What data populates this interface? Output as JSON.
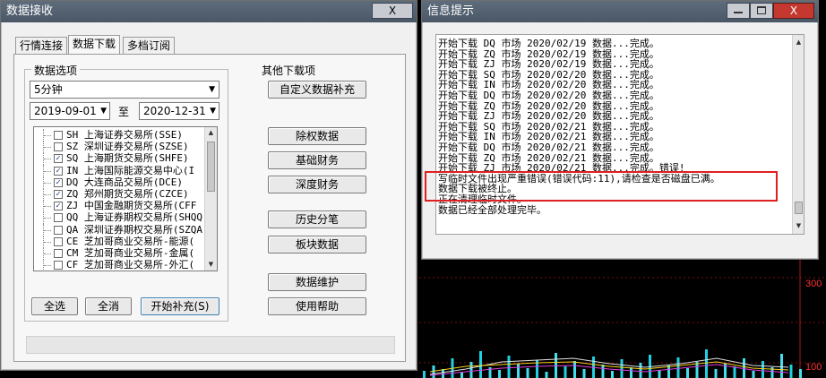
{
  "background": {
    "axis_labels": [
      "300",
      "100"
    ]
  },
  "data_window": {
    "title": "数据接收",
    "close_label": "X",
    "tabs": [
      "行情连接",
      "数据下载",
      "多档订阅"
    ],
    "active_tab": "数据下载",
    "data_options": {
      "group_title": "数据选项",
      "period": "5分钟",
      "start_date": "2019-09-01",
      "to_label": "至",
      "end_date": "2020-12-31",
      "markets": [
        {
          "checked": false,
          "text": "SH 上海证券交易所(SSE)"
        },
        {
          "checked": false,
          "text": "SZ 深圳证券交易所(SZSE)"
        },
        {
          "checked": true,
          "text": "SQ 上海期货交易所(SHFE)"
        },
        {
          "checked": true,
          "text": "IN 上海国际能源交易中心(I"
        },
        {
          "checked": true,
          "text": "DQ 大连商品交易所(DCE)"
        },
        {
          "checked": true,
          "text": "ZQ 郑州期货交易所(CZCE)"
        },
        {
          "checked": true,
          "text": "ZJ 中国金融期货交易所(CFF"
        },
        {
          "checked": false,
          "text": "QQ 上海证券期权交易所(SHQQ)"
        },
        {
          "checked": false,
          "text": "QA 深圳证券期权交易所(SZQA)"
        },
        {
          "checked": false,
          "text": "CE 芝加哥商业交易所-能源("
        },
        {
          "checked": false,
          "text": "CM 芝加哥商业交易所-金属("
        },
        {
          "checked": false,
          "text": "CF 芝加哥商业交易所-外汇("
        }
      ],
      "select_all": "全选",
      "select_none": "全消",
      "start_supplement": "开始补充(S)"
    },
    "other_downloads": {
      "group_title": "其他下载项",
      "custom_supplement": "自定义数据补充",
      "buttons": [
        "除权数据",
        "基础财务",
        "深度财务",
        "历史分笔",
        "板块数据"
      ],
      "data_maintenance": "数据维护",
      "help": "使用帮助"
    }
  },
  "info_window": {
    "title": "信息提示",
    "log_lines": [
      "开始下载 DQ 市场 2020/02/19 数据...完成。",
      "开始下载 ZQ 市场 2020/02/19 数据...完成。",
      "开始下载 ZJ 市场 2020/02/19 数据...完成。",
      "开始下载 SQ 市场 2020/02/20 数据...完成。",
      "开始下载 IN 市场 2020/02/20 数据...完成。",
      "开始下载 DQ 市场 2020/02/20 数据...完成。",
      "开始下载 ZQ 市场 2020/02/20 数据...完成。",
      "开始下载 ZJ 市场 2020/02/20 数据...完成。",
      "开始下载 SQ 市场 2020/02/21 数据...完成。",
      "开始下载 IN 市场 2020/02/21 数据...完成。",
      "开始下载 DQ 市场 2020/02/21 数据...完成。",
      "开始下载 ZQ 市场 2020/02/21 数据...完成。",
      "开始下载 ZJ 市场 2020/02/21 数据...完成。错误!",
      "写临时文件出现严重错误(错误代码:11),请检查是否磁盘已满。",
      "数据下载被终止。",
      "正在清理临时文件。",
      "数据已经全部处理完毕。"
    ]
  }
}
